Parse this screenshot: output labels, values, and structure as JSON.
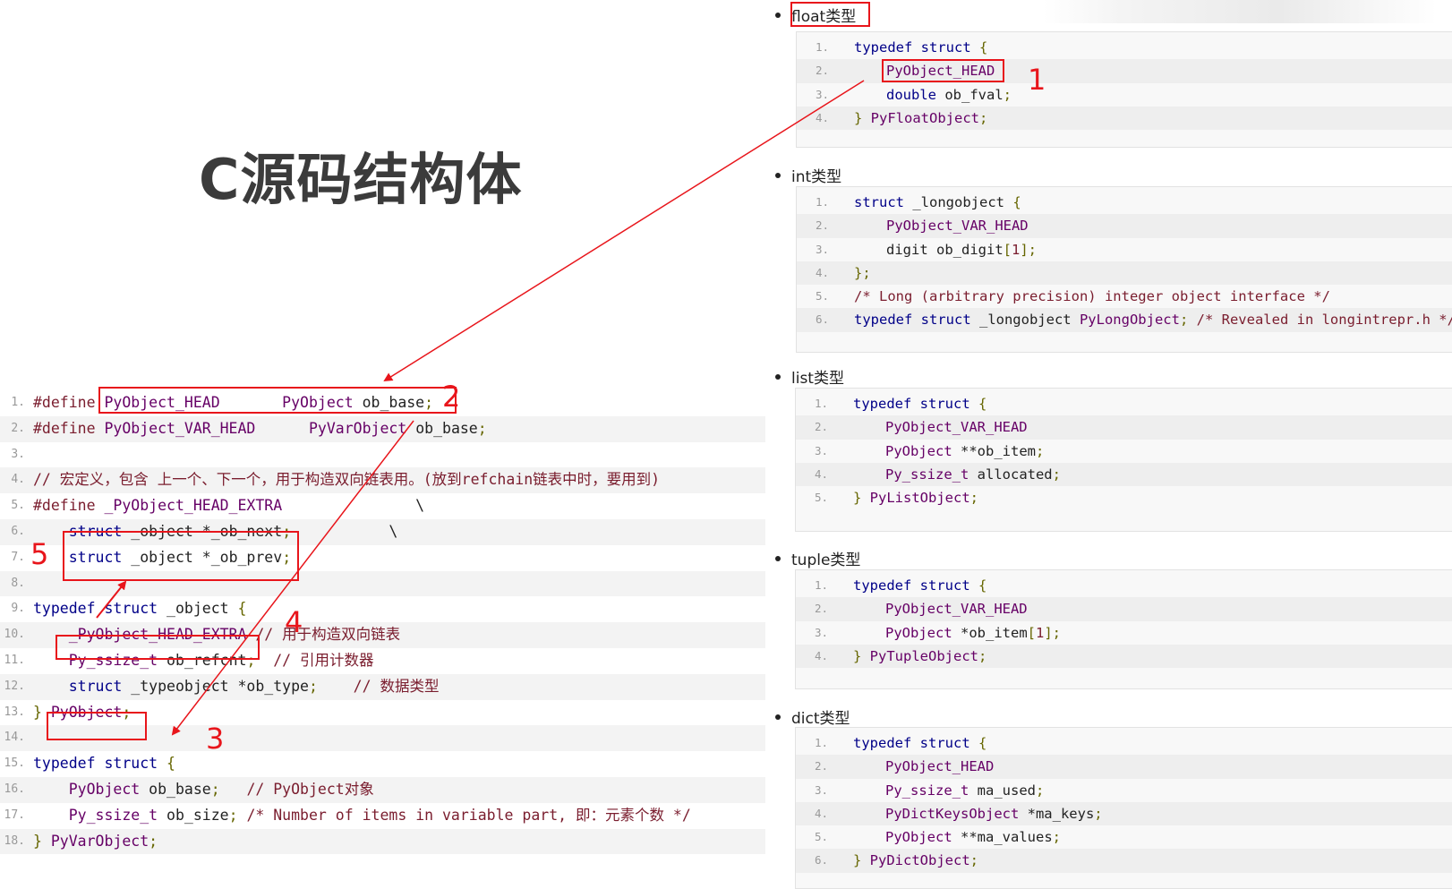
{
  "title": "C源码结构体",
  "left_code": [
    [
      [
        "pp",
        "#define "
      ],
      [
        "tp",
        "PyObject_HEAD"
      ],
      [
        "pl",
        "       "
      ],
      [
        "tp",
        "PyObject "
      ],
      [
        "pl",
        "ob_base"
      ],
      [
        "pu",
        ";"
      ]
    ],
    [
      [
        "pp",
        "#define "
      ],
      [
        "tp",
        "PyObject_VAR_HEAD"
      ],
      [
        "pl",
        "      "
      ],
      [
        "tp",
        "PyVarObject "
      ],
      [
        "pl",
        "ob_base"
      ],
      [
        "pu",
        ";"
      ]
    ],
    [],
    [
      [
        "cm",
        "// 宏定义，包含 上一个、下一个，用于构造双向链表用。(放到refchain链表中时，要用到)"
      ]
    ],
    [
      [
        "pp",
        "#define "
      ],
      [
        "tp",
        "_PyObject_HEAD_EXTRA"
      ],
      [
        "pl",
        "               \\"
      ]
    ],
    [
      [
        "pl",
        "    "
      ],
      [
        "kw",
        "struct "
      ],
      [
        "pl",
        "_object *_ob_next"
      ],
      [
        "pu",
        ";"
      ],
      [
        "pl",
        "           \\"
      ]
    ],
    [
      [
        "pl",
        "    "
      ],
      [
        "kw",
        "struct "
      ],
      [
        "pl",
        "_object *_ob_prev"
      ],
      [
        "pu",
        ";"
      ]
    ],
    [],
    [
      [
        "kw",
        "typedef "
      ],
      [
        "kw",
        "struct "
      ],
      [
        "pl",
        "_object "
      ],
      [
        "pu",
        "{"
      ]
    ],
    [
      [
        "pl",
        "    "
      ],
      [
        "tp",
        "_PyObject_HEAD_EXTRA"
      ],
      [
        "cm",
        " // 用于构造双向链表"
      ]
    ],
    [
      [
        "pl",
        "    "
      ],
      [
        "tp",
        "Py_ssize_t "
      ],
      [
        "pl",
        "ob_refcnt"
      ],
      [
        "pu",
        ";"
      ],
      [
        "cm",
        "  // 引用计数器"
      ]
    ],
    [
      [
        "pl",
        "    "
      ],
      [
        "kw",
        "struct "
      ],
      [
        "pl",
        "_typeobject *ob_type"
      ],
      [
        "pu",
        ";"
      ],
      [
        "cm",
        "    // 数据类型"
      ]
    ],
    [
      [
        "pu",
        "} "
      ],
      [
        "tp",
        "PyObject"
      ],
      [
        "pu",
        ";"
      ]
    ],
    [],
    [
      [
        "kw",
        "typedef "
      ],
      [
        "kw",
        "struct "
      ],
      [
        "pu",
        "{"
      ]
    ],
    [
      [
        "pl",
        "    "
      ],
      [
        "tp",
        "PyObject "
      ],
      [
        "pl",
        "ob_base"
      ],
      [
        "pu",
        ";"
      ],
      [
        "cm",
        "   // PyObject对象"
      ]
    ],
    [
      [
        "pl",
        "    "
      ],
      [
        "tp",
        "Py_ssize_t "
      ],
      [
        "pl",
        "ob_size"
      ],
      [
        "pu",
        ";"
      ],
      [
        "cm",
        " /* Number of items in variable part, 即：元素个数 */"
      ]
    ],
    [
      [
        "pu",
        "} "
      ],
      [
        "tp",
        "PyVarObject"
      ],
      [
        "pu",
        ";"
      ]
    ]
  ],
  "sections": [
    {
      "label": "float类型",
      "lines": [
        [
          [
            "kw",
            "typedef "
          ],
          [
            "kw",
            "struct "
          ],
          [
            "pu",
            "{"
          ]
        ],
        [
          [
            "ind",
            ""
          ],
          [
            "tp",
            "PyObject_HEAD"
          ]
        ],
        [
          [
            "ind",
            ""
          ],
          [
            "kw",
            "double "
          ],
          [
            "pl",
            "ob_fval"
          ],
          [
            "pu",
            ";"
          ]
        ],
        [
          [
            "pu",
            "} "
          ],
          [
            "tp",
            "PyFloatObject"
          ],
          [
            "pu",
            ";"
          ]
        ]
      ]
    },
    {
      "label": "int类型",
      "lines": [
        [
          [
            "kw",
            "struct "
          ],
          [
            "pl",
            "_longobject "
          ],
          [
            "pu",
            "{"
          ]
        ],
        [
          [
            "ind",
            ""
          ],
          [
            "tp",
            "PyObject_VAR_HEAD"
          ]
        ],
        [
          [
            "ind",
            ""
          ],
          [
            "pl",
            "digit ob_digit"
          ],
          [
            "pu",
            "["
          ],
          [
            "pp",
            "1"
          ],
          [
            "pu",
            "];"
          ]
        ],
        [
          [
            "pu",
            "};"
          ]
        ],
        [
          [
            "cm",
            "/* Long (arbitrary precision) integer object interface */"
          ]
        ],
        [
          [
            "kw",
            "typedef "
          ],
          [
            "kw",
            "struct "
          ],
          [
            "pl",
            "_longobject "
          ],
          [
            "tp",
            "PyLongObject"
          ],
          [
            "pu",
            ";"
          ],
          [
            "cm",
            " /* Revealed in longintrepr.h */"
          ]
        ]
      ]
    },
    {
      "label": "list类型",
      "lines": [
        [
          [
            "kw",
            "typedef "
          ],
          [
            "kw",
            "struct "
          ],
          [
            "pu",
            "{"
          ]
        ],
        [
          [
            "ind",
            ""
          ],
          [
            "tp",
            "PyObject_VAR_HEAD"
          ]
        ],
        [
          [
            "ind",
            ""
          ],
          [
            "tp",
            "PyObject "
          ],
          [
            "pl",
            "**ob_item"
          ],
          [
            "pu",
            ";"
          ]
        ],
        [
          [
            "ind",
            ""
          ],
          [
            "tp",
            "Py_ssize_t "
          ],
          [
            "pl",
            "allocated"
          ],
          [
            "pu",
            ";"
          ]
        ],
        [
          [
            "pu",
            "} "
          ],
          [
            "tp",
            "PyListObject"
          ],
          [
            "pu",
            ";"
          ]
        ]
      ]
    },
    {
      "label": "tuple类型",
      "lines": [
        [
          [
            "kw",
            "typedef "
          ],
          [
            "kw",
            "struct "
          ],
          [
            "pu",
            "{"
          ]
        ],
        [
          [
            "ind",
            ""
          ],
          [
            "tp",
            "PyObject_VAR_HEAD"
          ]
        ],
        [
          [
            "ind",
            ""
          ],
          [
            "tp",
            "PyObject "
          ],
          [
            "pl",
            "*ob_item"
          ],
          [
            "pu",
            "["
          ],
          [
            "pp",
            "1"
          ],
          [
            "pu",
            "];"
          ]
        ],
        [
          [
            "pu",
            "} "
          ],
          [
            "tp",
            "PyTupleObject"
          ],
          [
            "pu",
            ";"
          ]
        ]
      ]
    },
    {
      "label": "dict类型",
      "lines": [
        [
          [
            "kw",
            "typedef "
          ],
          [
            "kw",
            "struct "
          ],
          [
            "pu",
            "{"
          ]
        ],
        [
          [
            "ind",
            ""
          ],
          [
            "tp",
            "PyObject_HEAD"
          ]
        ],
        [
          [
            "ind",
            ""
          ],
          [
            "tp",
            "Py_ssize_t "
          ],
          [
            "pl",
            "ma_used"
          ],
          [
            "pu",
            ";"
          ]
        ],
        [
          [
            "ind",
            ""
          ],
          [
            "tp",
            "PyDictKeysObject "
          ],
          [
            "pl",
            "*ma_keys"
          ],
          [
            "pu",
            ";"
          ]
        ],
        [
          [
            "ind",
            ""
          ],
          [
            "tp",
            "PyObject "
          ],
          [
            "pl",
            "**ma_values"
          ],
          [
            "pu",
            ";"
          ]
        ],
        [
          [
            "pu",
            "} "
          ],
          [
            "tp",
            "PyDictObject"
          ],
          [
            "pu",
            ";"
          ]
        ]
      ]
    }
  ],
  "annotations": [
    "1",
    "2",
    "3",
    "4",
    "5"
  ],
  "colors": {
    "annotation_red": "#e8151b",
    "title_gray": "#3b3b3b"
  }
}
